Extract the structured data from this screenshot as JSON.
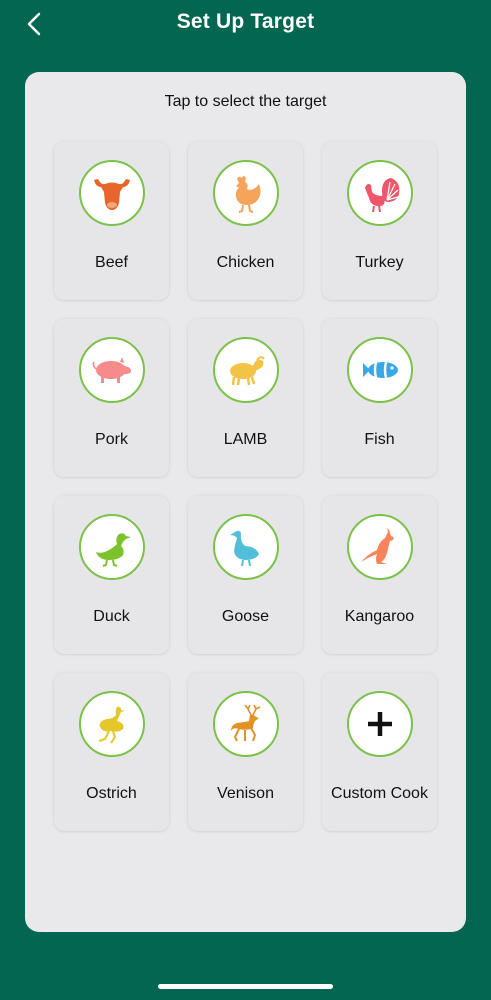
{
  "header": {
    "title": "Set Up Target"
  },
  "subtitle": "Tap to select the target",
  "targets": [
    {
      "label": "Beef",
      "icon": "cow-head-icon",
      "color": "#e8652b"
    },
    {
      "label": "Chicken",
      "icon": "chicken-icon",
      "color": "#f6a45a"
    },
    {
      "label": "Turkey",
      "icon": "turkey-icon",
      "color": "#f0566a"
    },
    {
      "label": "Pork",
      "icon": "pig-icon",
      "color": "#f78a8a"
    },
    {
      "label": "LAMB",
      "icon": "lamb-icon",
      "color": "#f2c345"
    },
    {
      "label": "Fish",
      "icon": "fish-icon",
      "color": "#3ba8e6"
    },
    {
      "label": "Duck",
      "icon": "duck-icon",
      "color": "#7cc22c"
    },
    {
      "label": "Goose",
      "icon": "goose-icon",
      "color": "#52bfd8"
    },
    {
      "label": "Kangaroo",
      "icon": "kangaroo-icon",
      "color": "#f7845a"
    },
    {
      "label": "Ostrich",
      "icon": "ostrich-icon",
      "color": "#e4c82a"
    },
    {
      "label": "Venison",
      "icon": "deer-icon",
      "color": "#e39024"
    },
    {
      "label": "Custom Cook",
      "icon": "plus-icon",
      "color": "#111111"
    }
  ]
}
